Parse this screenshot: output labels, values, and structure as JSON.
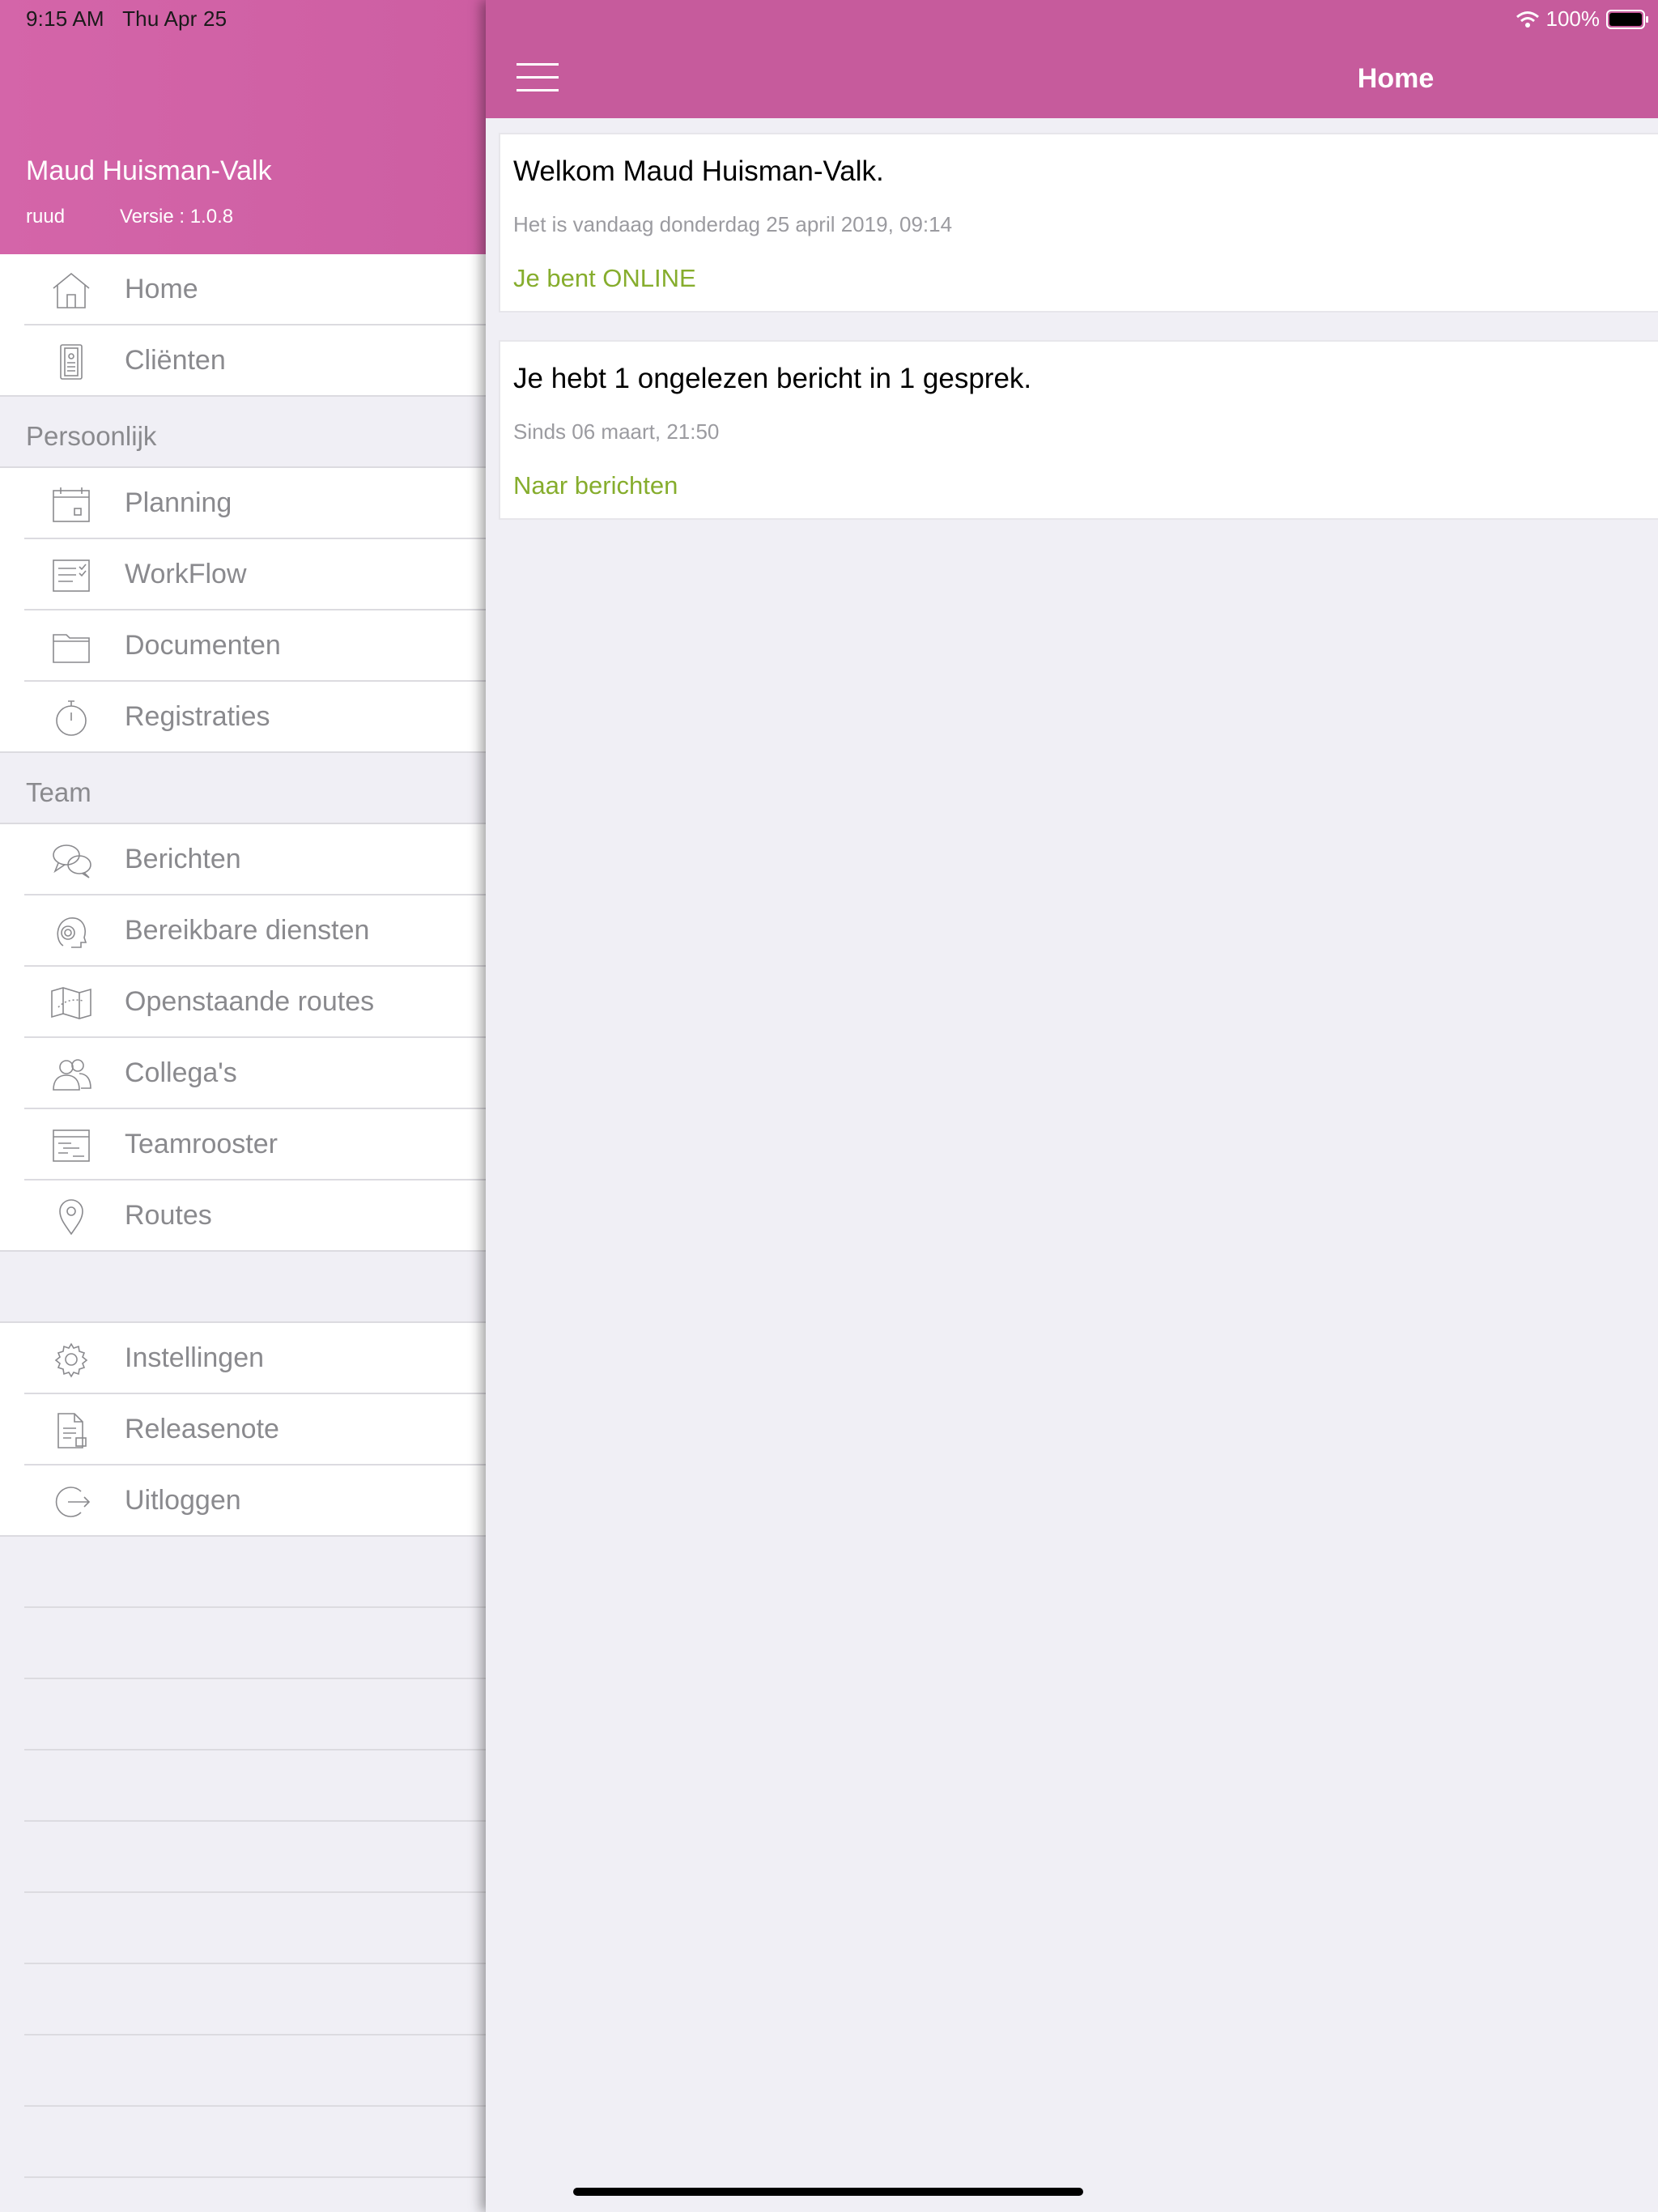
{
  "status_bar": {
    "time": "9:15 AM",
    "date": "Thu Apr 25",
    "battery": "100%"
  },
  "sidebar": {
    "profile": {
      "name": "Maud Huisman-Valk",
      "user": "ruud",
      "version": "Versie : 1.0.8"
    },
    "main_items": [
      {
        "label": "Home",
        "icon": "home-icon"
      },
      {
        "label": "Cliënten",
        "icon": "client-badge-icon"
      }
    ],
    "sections": [
      {
        "title": "Persoonlijk",
        "items": [
          {
            "label": "Planning",
            "icon": "calendar-icon"
          },
          {
            "label": "WorkFlow",
            "icon": "checklist-icon"
          },
          {
            "label": "Documenten",
            "icon": "folder-icon"
          },
          {
            "label": "Registraties",
            "icon": "stopwatch-icon"
          }
        ]
      },
      {
        "title": "Team",
        "items": [
          {
            "label": "Berichten",
            "icon": "chat-bubbles-icon"
          },
          {
            "label": "Bereikbare diensten",
            "icon": "headset-icon"
          },
          {
            "label": "Openstaande routes",
            "icon": "map-icon"
          },
          {
            "label": "Collega's",
            "icon": "people-icon"
          },
          {
            "label": "Teamrooster",
            "icon": "roster-icon"
          },
          {
            "label": "Routes",
            "icon": "location-pin-icon"
          }
        ]
      }
    ],
    "bottom_items": [
      {
        "label": "Instellingen",
        "icon": "gear-icon"
      },
      {
        "label": "Releasenote",
        "icon": "document-icon"
      },
      {
        "label": "Uitloggen",
        "icon": "logout-icon"
      }
    ]
  },
  "navbar": {
    "title": "Home"
  },
  "cards": [
    {
      "title": "Welkom Maud Huisman-Valk.",
      "subtitle": "Het is vandaag donderdag 25 april 2019, 09:14",
      "link": "Je bent ONLINE"
    },
    {
      "title": "Je hebt 1 ongelezen bericht in 1 gesprek.",
      "subtitle": "Sinds 06 maart, 21:50",
      "link": "Naar berichten"
    }
  ],
  "colors": {
    "accent": "#c65b9c",
    "link_green": "#86ad2d",
    "muted_text": "#8a8a8e"
  }
}
